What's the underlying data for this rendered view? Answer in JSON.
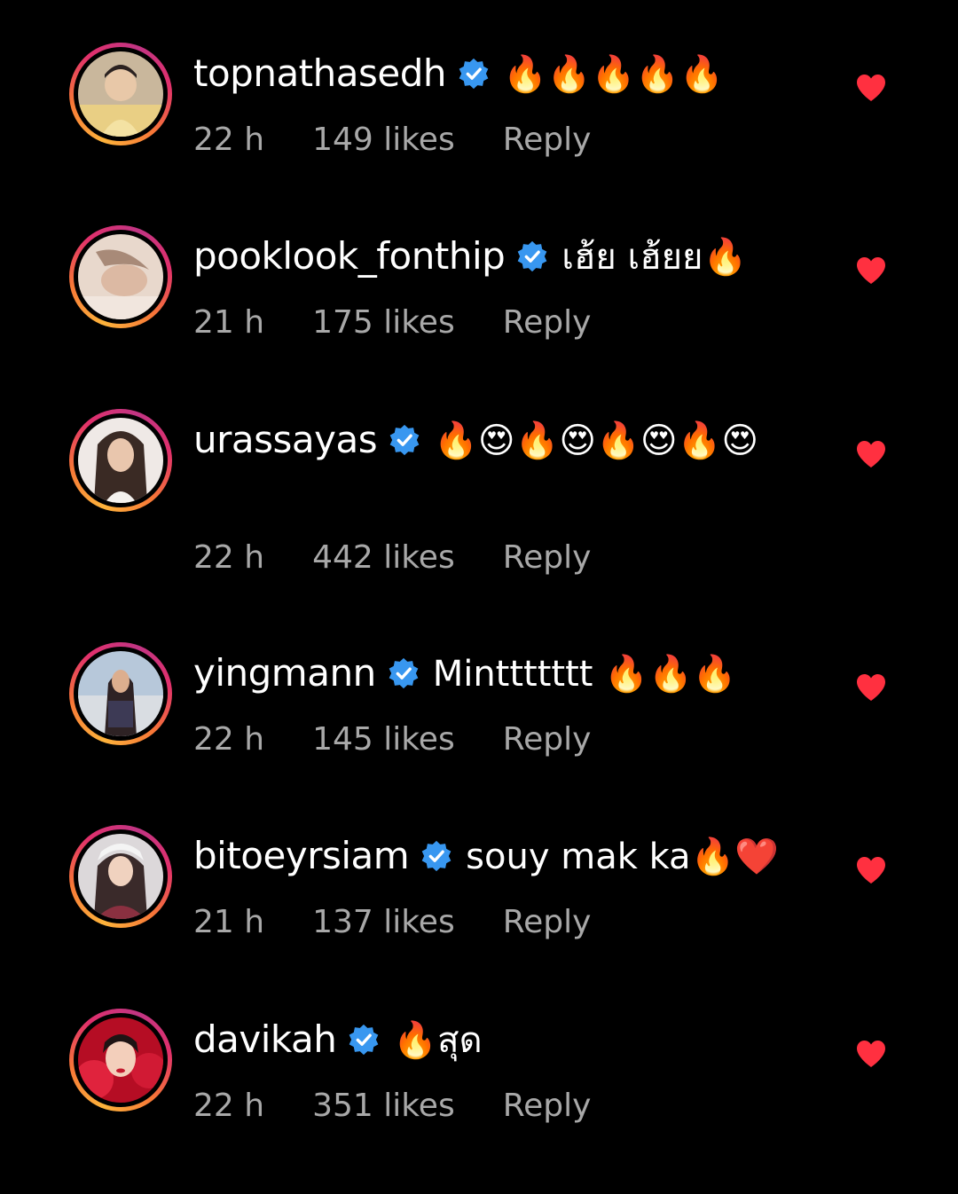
{
  "comments": [
    {
      "username": "topnathasedh",
      "verified": true,
      "text": "🔥🔥🔥🔥🔥",
      "time": "22 h",
      "likes": "149 likes",
      "reply": "Reply",
      "liked": true,
      "avatar_colors": [
        "#d9c3a5",
        "#f2d07a"
      ]
    },
    {
      "username": "pooklook_fonthip",
      "verified": true,
      "text": "เฮ้ย เฮ้ยย🔥",
      "time": "21 h",
      "likes": "175 likes",
      "reply": "Reply",
      "liked": true,
      "avatar_colors": [
        "#e6d2c4",
        "#b89a8a"
      ]
    },
    {
      "username": "urassayas",
      "verified": true,
      "text": "🔥😍🔥😍🔥😍🔥😍",
      "time": "22 h",
      "likes": "442 likes",
      "reply": "Reply",
      "liked": true,
      "avatar_colors": [
        "#ece6e2",
        "#3a2a24"
      ]
    },
    {
      "username": "yingmann",
      "verified": true,
      "text": "Minttttttt 🔥🔥🔥",
      "time": "22 h",
      "likes": "145 likes",
      "reply": "Reply",
      "liked": true,
      "avatar_colors": [
        "#aebfd2",
        "#3b2c2e"
      ]
    },
    {
      "username": "bitoeyrsiam",
      "verified": true,
      "text": "souy mak ka🔥❤️",
      "time": "21 h",
      "likes": "137 likes",
      "reply": "Reply",
      "liked": true,
      "avatar_colors": [
        "#d8d4d6",
        "#8a3040"
      ]
    },
    {
      "username": "davikah",
      "verified": true,
      "text": "🔥สุด",
      "time": "22 h",
      "likes": "351 likes",
      "reply": "Reply",
      "liked": true,
      "avatar_colors": [
        "#c8102e",
        "#f1c9b4"
      ]
    }
  ],
  "colors": {
    "background": "#000000",
    "verified_badge": "#3897f0",
    "heart": "#ff3040",
    "meta_text": "#a8a8a8"
  }
}
